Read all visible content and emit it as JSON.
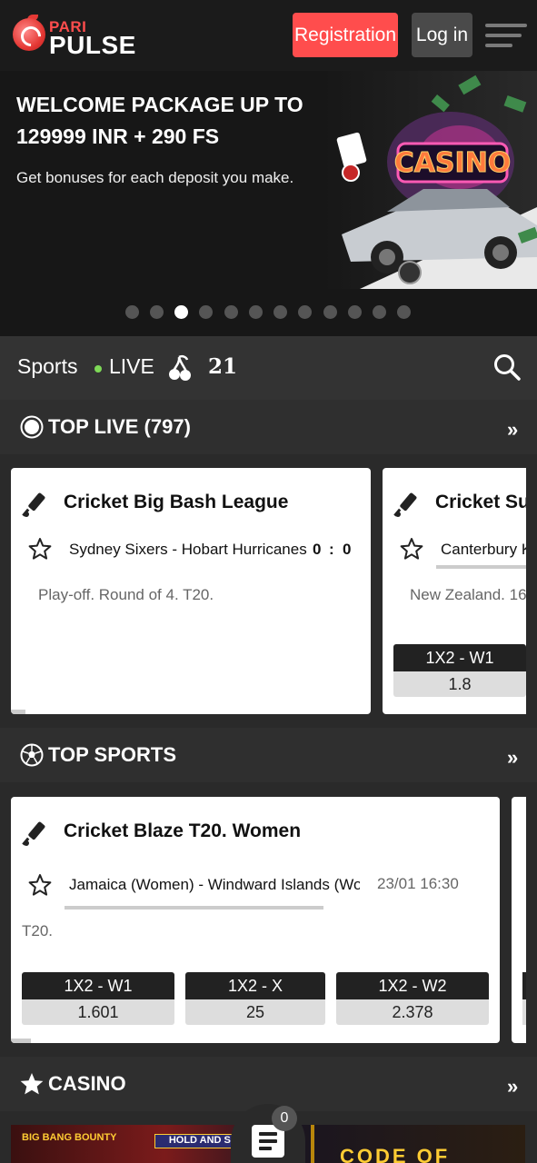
{
  "header": {
    "logo_top": "PARI",
    "logo_bottom": "PULSE",
    "register_label": "Registration",
    "login_label": "Log in",
    "menu_icon": "hamburger-menu-icon"
  },
  "banner": {
    "title": "WELCOME PACKAGE UP TO 129999 INR + 290 FS",
    "subtitle": "Get bonuses for each deposit you make.",
    "art_text": "CASINO",
    "slide_count": 12,
    "active_slide": 3
  },
  "sports_nav": {
    "sports_label": "Sports",
    "live_label": "LIVE",
    "slots_icon": "cherries-icon",
    "twentyone_label": "21",
    "search_icon": "search-icon"
  },
  "top_live": {
    "title": "TOP LIVE (797)",
    "icon": "live-icon",
    "cards": [
      {
        "league": "Cricket Big Bash League",
        "teams": "Sydney Sixers - Hobart Hurricanes",
        "score_home": "0",
        "score_sep": ":",
        "score_away": "0",
        "info": "Play-off. Round of 4. T20."
      },
      {
        "league": "Cricket Su",
        "teams": "Canterbury K",
        "info": "New Zealand. 16",
        "odds": [
          {
            "label": "1X2 - W1",
            "value": "1.8"
          }
        ]
      }
    ]
  },
  "top_sports": {
    "title": "TOP SPORTS",
    "icon": "football-icon",
    "cards": [
      {
        "league": "Cricket Blaze T20. Women",
        "teams": "Jamaica (Women) - Windward Islands (Wo",
        "date": "23/01 16:30",
        "info": "T20.",
        "odds": [
          {
            "label": "1X2 - W1",
            "value": "1.601"
          },
          {
            "label": "1X2 - X",
            "value": "25"
          },
          {
            "label": "1X2 - W2",
            "value": "2.378"
          }
        ]
      }
    ]
  },
  "casino": {
    "title": "CASINO",
    "icon": "star-icon",
    "strip": {
      "game1": "BIG BANG BOUNTY",
      "game2": "HOLD AND SPIN",
      "game3": "CODE OF"
    }
  },
  "betslip": {
    "count": "0"
  },
  "colors": {
    "accent": "#ff4d4d",
    "live_dot": "#7ed957",
    "header_bg": "#1b1b1b",
    "page_bg": "#2a2a2a"
  }
}
